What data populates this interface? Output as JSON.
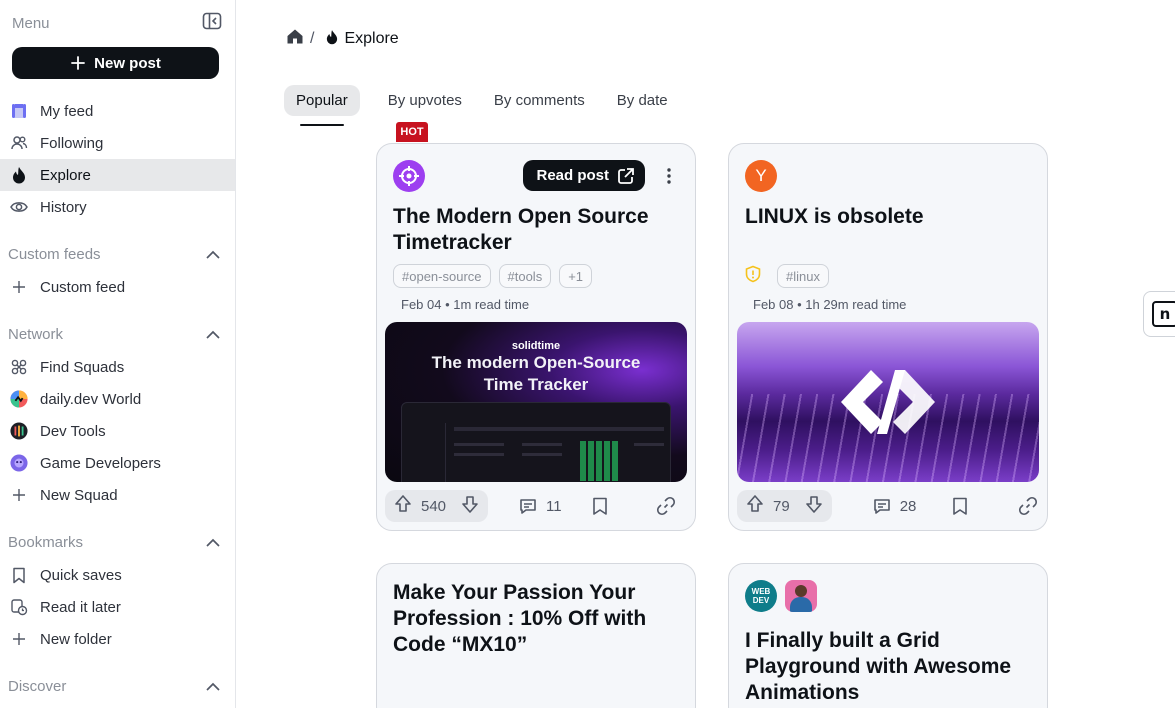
{
  "sidebar": {
    "menu_title": "Menu",
    "new_post_label": "New post",
    "items": [
      {
        "label": "My feed",
        "icon": "my-feed-icon"
      },
      {
        "label": "Following",
        "icon": "following-icon"
      },
      {
        "label": "Explore",
        "icon": "flame-icon",
        "active": true
      },
      {
        "label": "History",
        "icon": "eye-icon"
      }
    ],
    "custom_feeds": {
      "title": "Custom feeds",
      "items": [
        {
          "label": "Custom feed",
          "icon": "plus-icon"
        }
      ]
    },
    "network": {
      "title": "Network",
      "items": [
        {
          "label": "Find Squads",
          "icon": "squads-icon"
        },
        {
          "label": "daily.dev World",
          "icon": "daily-world-icon"
        },
        {
          "label": "Dev Tools",
          "icon": "dev-tools-icon"
        },
        {
          "label": "Game Developers",
          "icon": "game-developers-icon"
        },
        {
          "label": "New Squad",
          "icon": "plus-icon"
        }
      ]
    },
    "bookmarks": {
      "title": "Bookmarks",
      "items": [
        {
          "label": "Quick saves",
          "icon": "bookmark-icon"
        },
        {
          "label": "Read it later",
          "icon": "read-later-icon"
        },
        {
          "label": "New folder",
          "icon": "plus-icon"
        }
      ]
    },
    "discover": {
      "title": "Discover"
    }
  },
  "breadcrumb": {
    "separator": "/",
    "current": "Explore"
  },
  "tabs": [
    {
      "label": "Popular",
      "active": true
    },
    {
      "label": "By upvotes"
    },
    {
      "label": "By comments"
    },
    {
      "label": "By date"
    }
  ],
  "cards": [
    {
      "badge": "HOT",
      "read_post_label": "Read post",
      "title": "The Modern Open Source Timetracker",
      "tags": [
        "#open-source",
        "#tools",
        "+1"
      ],
      "meta": "Feb 04 • 1m read time",
      "thumb_brand": "solidtime",
      "thumb_headline_1": "The modern Open-Source",
      "thumb_headline_2": "Time Tracker",
      "upvotes": "540",
      "comments": "11"
    },
    {
      "title": "LINUX is obsolete",
      "source_letter": "Y",
      "tags": [
        "#linux"
      ],
      "meta": "Feb 08 • 1h 29m read time",
      "upvotes": "79",
      "comments": "28"
    },
    {
      "title": "Make Your Passion Your Profession : 10% Off with Code “MX10”"
    },
    {
      "title": "I Finally built a Grid Playground with Awesome Animations",
      "source_label": "WEB DEV"
    }
  ],
  "colors": {
    "accent_dark": "#0e1217",
    "hot_red": "#c7121f",
    "active_bg": "#e7e8ea"
  }
}
